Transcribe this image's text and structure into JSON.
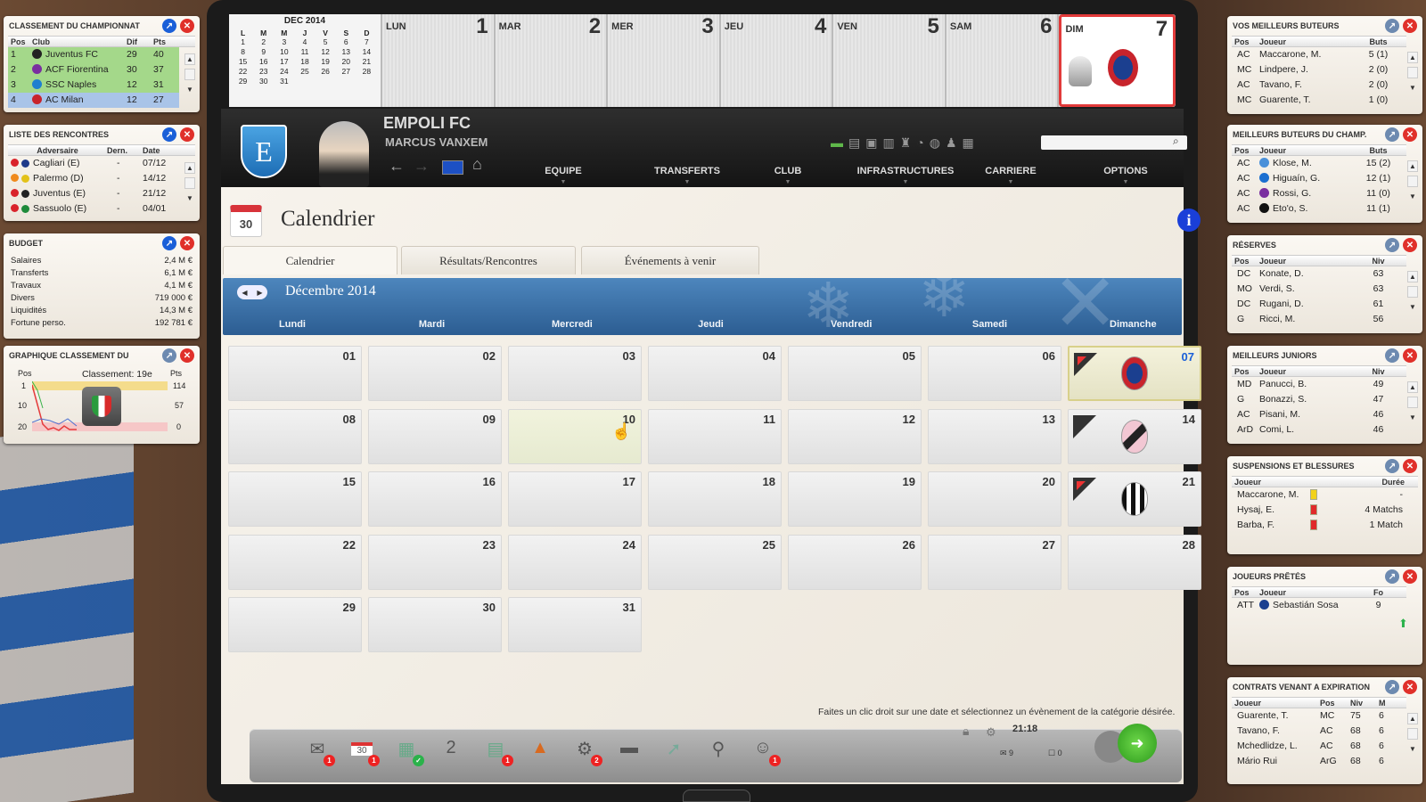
{
  "left": {
    "championship": {
      "title": "CLASSEMENT DU CHAMPIONNAT",
      "cols": [
        "Pos",
        "Club",
        "Dif",
        "Pts"
      ],
      "rows": [
        {
          "pos": "1",
          "club": "Juventus FC",
          "dif": "29",
          "pts": "40"
        },
        {
          "pos": "2",
          "club": "ACF Fiorentina",
          "dif": "30",
          "pts": "37"
        },
        {
          "pos": "3",
          "club": "SSC Naples",
          "dif": "12",
          "pts": "31"
        },
        {
          "pos": "4",
          "club": "AC Milan",
          "dif": "12",
          "pts": "27"
        }
      ]
    },
    "matches": {
      "title": "LISTE DES RENCONTRES",
      "cols": [
        "Adversaire",
        "Dern.",
        "Date"
      ],
      "rows": [
        {
          "opp": "Cagliari (E)",
          "last": "-",
          "date": "07/12",
          "dot": "#d9232b"
        },
        {
          "opp": "Palermo (D)",
          "last": "-",
          "date": "14/12",
          "dot": "#f08a1c"
        },
        {
          "opp": "Juventus (E)",
          "last": "-",
          "date": "21/12",
          "dot": "#d9232b"
        },
        {
          "opp": "Sassuolo (E)",
          "last": "-",
          "date": "04/01",
          "dot": "#d9232b"
        }
      ]
    },
    "budget": {
      "title": "BUDGET",
      "rows": [
        {
          "label": "Salaires",
          "value": "2,4 M €"
        },
        {
          "label": "Transferts",
          "value": "6,1 M €"
        },
        {
          "label": "Travaux",
          "value": "4,1 M €"
        },
        {
          "label": "Divers",
          "value": "719 000 €"
        },
        {
          "label": "Liquidités",
          "value": "14,3 M €"
        },
        {
          "label": "Fortune perso.",
          "value": "192 781 €"
        }
      ]
    },
    "graph": {
      "title": "GRAPHIQUE CLASSEMENT DU",
      "pos_label": "Pos",
      "pts_label": "Pts",
      "classement": "Classement: 19e",
      "y_left": [
        "1",
        "10",
        "20"
      ],
      "y_right": [
        "114",
        "57",
        "0"
      ]
    }
  },
  "topcal": {
    "month": "DEC 2014",
    "mini_heads": [
      "L",
      "M",
      "M",
      "J",
      "V",
      "S",
      "D"
    ],
    "mini_rows": [
      [
        "1",
        "2",
        "3",
        "4",
        "5",
        "6",
        "7"
      ],
      [
        "8",
        "9",
        "10",
        "11",
        "12",
        "13",
        "14"
      ],
      [
        "15",
        "16",
        "17",
        "18",
        "19",
        "20",
        "21"
      ],
      [
        "22",
        "23",
        "24",
        "25",
        "26",
        "27",
        "28"
      ],
      [
        "29",
        "30",
        "31",
        "",
        "",
        "",
        ""
      ]
    ],
    "days": [
      {
        "name": "LUN",
        "num": "1"
      },
      {
        "name": "MAR",
        "num": "2"
      },
      {
        "name": "MER",
        "num": "3"
      },
      {
        "name": "JEU",
        "num": "4"
      },
      {
        "name": "VEN",
        "num": "5"
      },
      {
        "name": "SAM",
        "num": "6"
      },
      {
        "name": "DIM",
        "num": "7"
      }
    ]
  },
  "header": {
    "club": "EMPOLI FC",
    "manager": "MARCUS VANXEM",
    "club_letter": "E",
    "menu": [
      "EQUIPE",
      "TRANSFERTS",
      "CLUB",
      "INFRASTRUCTURES",
      "CARRIERE",
      "OPTIONS"
    ],
    "search_placeholder": ""
  },
  "calendar": {
    "title": "Calendrier",
    "icon_day": "30",
    "tabs": [
      "Calendrier",
      "Résultats/Rencontres",
      "Événements à venir"
    ],
    "month": "Décembre 2014",
    "weekdays": [
      "Lundi",
      "Mardi",
      "Mercredi",
      "Jeudi",
      "Vendredi",
      "Samedi",
      "Dimanche"
    ],
    "cells": [
      [
        "01",
        "02",
        "03",
        "04",
        "05",
        "06",
        "07"
      ],
      [
        "08",
        "09",
        "10",
        "11",
        "12",
        "13",
        "14"
      ],
      [
        "15",
        "16",
        "17",
        "18",
        "19",
        "20",
        "21"
      ],
      [
        "22",
        "23",
        "24",
        "25",
        "26",
        "27",
        "28"
      ],
      [
        "29",
        "30",
        "31"
      ]
    ],
    "hint": "Faites un clic droit sur une date et sélectionnez un évènement de la catégorie désirée."
  },
  "bottom": {
    "time": "21:18",
    "mail_count": "9",
    "msg_count": "0",
    "badges": {
      "mail": "1",
      "cal": "1",
      "b3": "1",
      "b5": "1",
      "b7": "2",
      "b10": "1"
    },
    "b4_num": "2",
    "cal_icon": "30"
  },
  "right": {
    "scorers": {
      "title": "VOS MEILLEURS BUTEURS",
      "cols": [
        "Pos",
        "Joueur",
        "Buts"
      ],
      "rows": [
        {
          "pos": "AC",
          "name": "Maccarone, M.",
          "val": "5 (1)"
        },
        {
          "pos": "MC",
          "name": "Lindpere, J.",
          "val": "2 (0)"
        },
        {
          "pos": "AC",
          "name": "Tavano, F.",
          "val": "2 (0)"
        },
        {
          "pos": "MC",
          "name": "Guarente, T.",
          "val": "1 (0)"
        }
      ]
    },
    "champ_scorers": {
      "title": "MEILLEURS BUTEURS DU CHAMP.",
      "cols": [
        "Pos",
        "Joueur",
        "Buts"
      ],
      "rows": [
        {
          "pos": "AC",
          "name": "Klose, M.",
          "val": "15 (2)"
        },
        {
          "pos": "AC",
          "name": "Higuaín, G.",
          "val": "12 (1)"
        },
        {
          "pos": "AC",
          "name": "Rossi, G.",
          "val": "11 (0)"
        },
        {
          "pos": "AC",
          "name": "Eto'o, S.",
          "val": "11 (1)"
        }
      ]
    },
    "reserves": {
      "title": "RÉSERVES",
      "cols": [
        "Pos",
        "Joueur",
        "Niv"
      ],
      "rows": [
        {
          "pos": "DC",
          "name": "Konate, D.",
          "val": "63"
        },
        {
          "pos": "MO",
          "name": "Verdi, S.",
          "val": "63"
        },
        {
          "pos": "DC",
          "name": "Rugani, D.",
          "val": "61"
        },
        {
          "pos": "G",
          "name": "Ricci, M.",
          "val": "56"
        }
      ]
    },
    "juniors": {
      "title": "MEILLEURS JUNIORS",
      "cols": [
        "Pos",
        "Joueur",
        "Niv"
      ],
      "rows": [
        {
          "pos": "MD",
          "name": "Panucci, B.",
          "val": "49"
        },
        {
          "pos": "G",
          "name": "Bonazzi, S.",
          "val": "47"
        },
        {
          "pos": "AC",
          "name": "Pisani, M.",
          "val": "46"
        },
        {
          "pos": "ArD",
          "name": "Comi, L.",
          "val": "46"
        }
      ]
    },
    "injuries": {
      "title": "SUSPENSIONS ET BLESSURES",
      "cols": [
        "Joueur",
        "Durée"
      ],
      "rows": [
        {
          "name": "Maccarone, M.",
          "val": "-",
          "card": "#f2d21a"
        },
        {
          "name": "Hysaj, E.",
          "val": "4 Matchs",
          "card": "#e02a2a"
        },
        {
          "name": "Barba, F.",
          "val": "1 Match",
          "card": "#e02a2a"
        }
      ]
    },
    "loaned": {
      "title": "JOUEURS PRÊTÉS",
      "cols": [
        "Pos",
        "Joueur",
        "Fo"
      ],
      "rows": [
        {
          "pos": "ATT",
          "name": "Sebastián Sosa",
          "val": "9"
        }
      ]
    },
    "contracts": {
      "title": "CONTRATS VENANT A EXPIRATION",
      "cols": [
        "Joueur",
        "Pos",
        "Niv",
        "M"
      ],
      "rows": [
        {
          "name": "Guarente, T.",
          "pos": "MC",
          "niv": "75",
          "m": "6"
        },
        {
          "name": "Tavano, F.",
          "pos": "AC",
          "niv": "68",
          "m": "6"
        },
        {
          "name": "Mchedlidze, L.",
          "pos": "AC",
          "niv": "68",
          "m": "6"
        },
        {
          "name": "Mário Rui",
          "pos": "ArG",
          "niv": "68",
          "m": "6"
        }
      ]
    }
  },
  "colors": {
    "accent": "#1a5fd8",
    "close": "#e0302a",
    "band": "#3b72a8",
    "today_border": "#e23a3a"
  }
}
